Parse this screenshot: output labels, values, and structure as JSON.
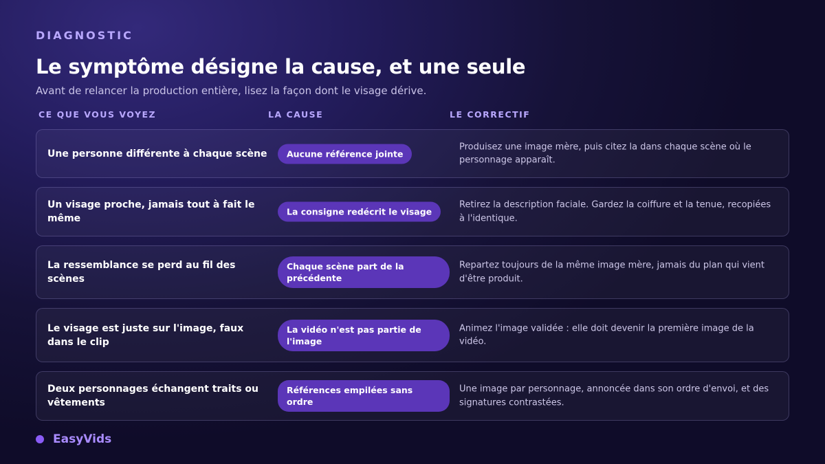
{
  "header": {
    "eyebrow": "DIAGNOSTIC",
    "title": "Le symptôme désigne la cause, et une seule",
    "subtitle": "Avant de relancer la production entière, lisez la façon dont le visage dérive."
  },
  "columns": {
    "symptom": "CE QUE VOUS VOYEZ",
    "cause": "LA CAUSE",
    "fix": "LE CORRECTIF"
  },
  "rows": [
    {
      "symptom": "Une personne différente à chaque scène",
      "cause": "Aucune référence jointe",
      "fix": "Produisez une image mère, puis citez la dans chaque scène où le personnage apparaît."
    },
    {
      "symptom": "Un visage proche, jamais tout à fait le même",
      "cause": "La consigne redécrit le visage",
      "fix": "Retirez la description faciale. Gardez la coiffure et la tenue, recopiées à l'identique."
    },
    {
      "symptom": "La ressemblance se perd au fil des scènes",
      "cause": "Chaque scène part de la précédente",
      "fix": "Repartez toujours de la même image mère, jamais du plan qui vient d'être produit."
    },
    {
      "symptom": "Le visage est juste sur l'image, faux dans le clip",
      "cause": "La vidéo n'est pas partie de l'image",
      "fix": "Animez l'image validée : elle doit devenir la première image de la vidéo."
    },
    {
      "symptom": "Deux personnages échangent traits ou vêtements",
      "cause": "Références empilées sans ordre",
      "fix": "Une image par personnage, annoncée dans son ordre d'envoi, et des signatures contrastées."
    }
  ],
  "footer": {
    "brand": "EasyVids"
  },
  "colors": {
    "accent": "#b9a8ff",
    "pill": "#5b36b8",
    "brand_dot": "#8a5cf6"
  }
}
